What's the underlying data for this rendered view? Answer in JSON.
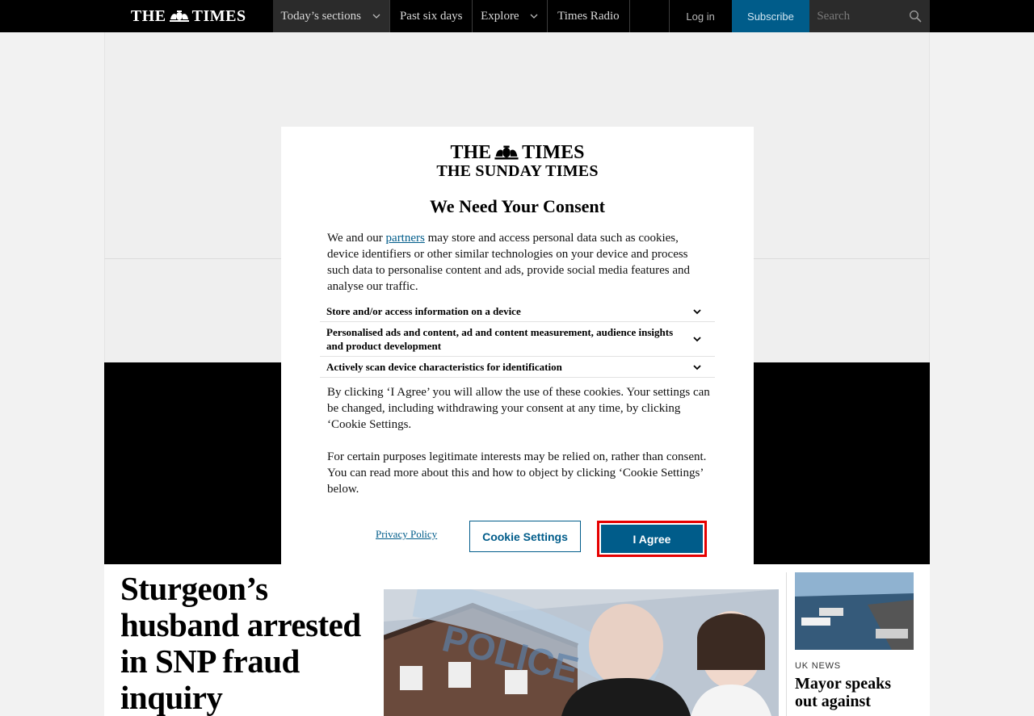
{
  "header": {
    "logo": {
      "left": "THE",
      "right": "TIMES"
    },
    "nav": {
      "sections": "Today’s sections",
      "past_six_days": "Past six days",
      "explore": "Explore",
      "radio": "Times Radio"
    },
    "login": "Log in",
    "subscribe": "Subscribe",
    "search_placeholder": "Search"
  },
  "consent": {
    "logo_line1": {
      "left": "THE",
      "right": "TIMES"
    },
    "logo_line2": "THE SUNDAY TIMES",
    "title": "We Need Your Consent",
    "intro_before_link": "We and our ",
    "intro_link": "partners",
    "intro_after_link": " may store and access personal data such as cookies, device identifiers or other similar technologies on your device and process such data to personalise content and ads, provide social media features and analyse our traffic.",
    "purposes": [
      "Store and/or access information on a device",
      "Personalised ads and content, ad and content measurement, audience insights and product development",
      "Actively scan device characteristics for identification"
    ],
    "paragraph2": "By clicking ‘I Agree’ you will allow the use of these cookies. Your settings can be changed, including withdrawing your consent at any time, by clicking ‘Cookie Settings.",
    "paragraph3": "For certain purposes legitimate interests may be relied on, rather than consent. You can read more about this and how to object by clicking ‘Cookie Settings’ below.",
    "privacy_policy": "Privacy Policy",
    "cookie_settings": "Cookie Settings",
    "agree": "I Agree"
  },
  "article": {
    "headline": "Sturgeon’s husband arrested in SNP fraud inquiry",
    "image_text": "POLICE",
    "side_category": "UK NEWS",
    "side_headline": "Mayor speaks out against"
  }
}
